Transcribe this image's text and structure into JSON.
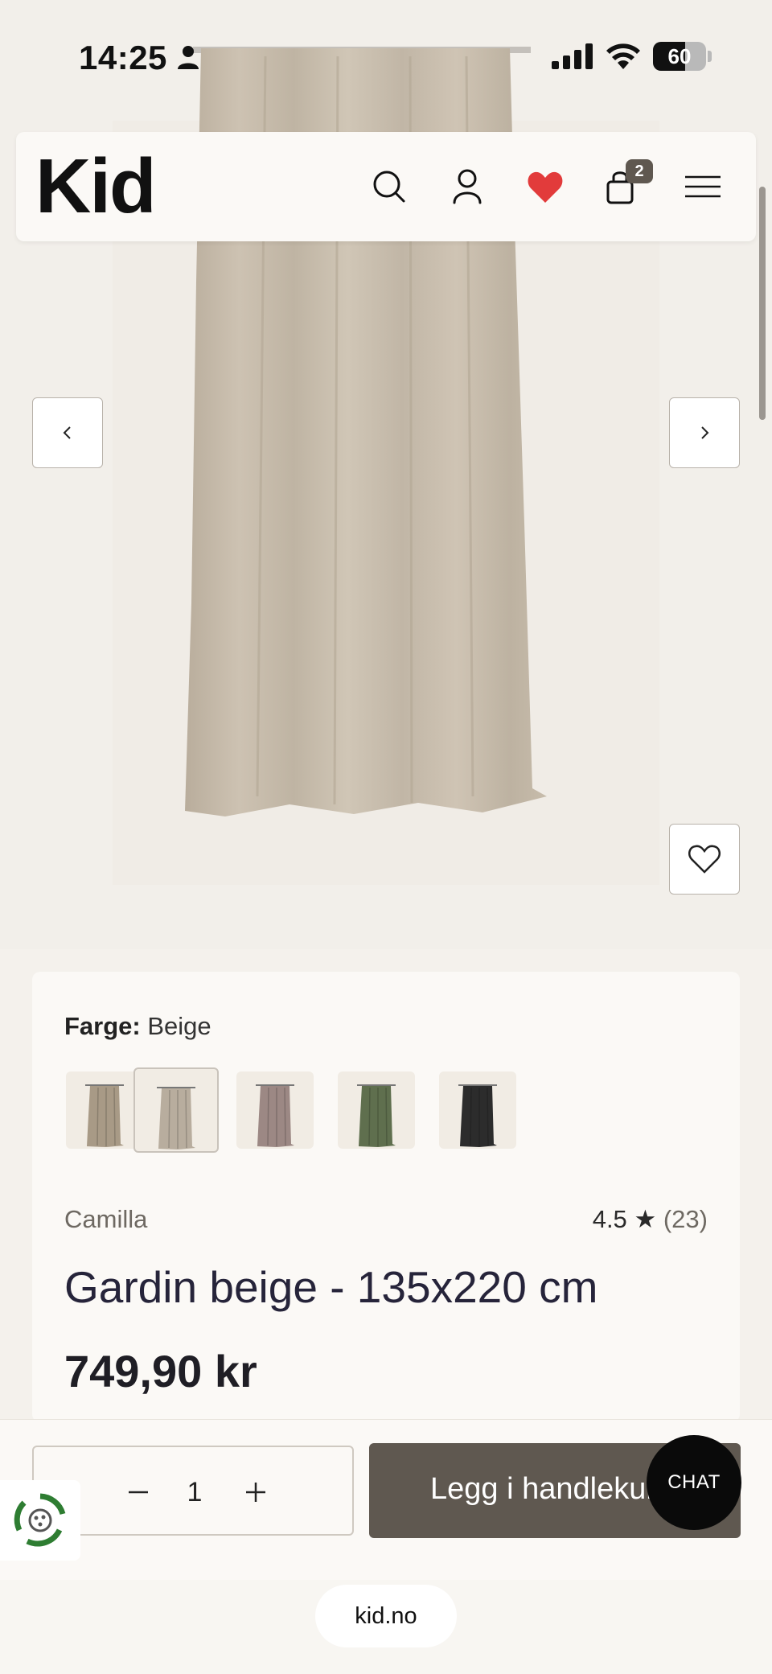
{
  "status_bar": {
    "time": "14:25",
    "battery": "60",
    "battery_level": 0.6
  },
  "header": {
    "logo": "Kid",
    "cart_count": "2",
    "icons": [
      "search-icon",
      "account-icon",
      "heart-icon",
      "bag-icon",
      "menu-icon"
    ],
    "heart_color": "#e23b3b"
  },
  "gallery": {
    "prev_icon": "chevron-left-icon",
    "next_icon": "chevron-right-icon",
    "wishlist_icon": "heart-outline-icon"
  },
  "product": {
    "color_label": "Farge:",
    "color_value": "Beige",
    "swatches": [
      {
        "name": "Taupe",
        "color": "#a89a86"
      },
      {
        "name": "Beige",
        "color": "#b8ad9e"
      },
      {
        "name": "Rosa",
        "color": "#9c8884"
      },
      {
        "name": "Grønn",
        "color": "#5f6f4e"
      },
      {
        "name": "Svart",
        "color": "#2c2c2c"
      }
    ],
    "brand": "Camilla",
    "rating": "4.5",
    "rating_star": "★",
    "review_count": "(23)",
    "title": "Gardin beige - 135x220 cm",
    "price": "749,90 kr"
  },
  "cart_actions": {
    "quantity": "1",
    "add_to_cart": "Legg i handlekurv",
    "chat": "CHAT"
  },
  "browser": {
    "url": "kid.no"
  },
  "colors": {
    "accent": "#5f5850",
    "background": "#f4f1ec",
    "card": "#fbf9f6"
  }
}
